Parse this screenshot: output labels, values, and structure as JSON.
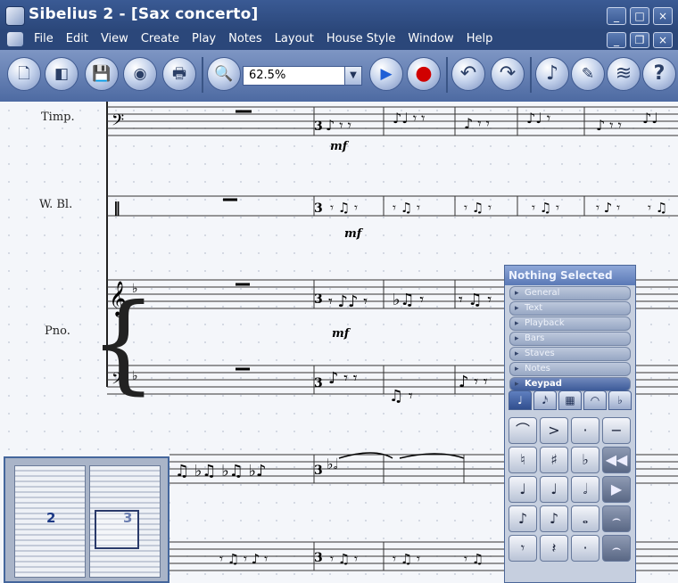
{
  "window": {
    "title": "Sibelius 2 - [Sax concerto]",
    "controls": [
      "_",
      "□",
      "×"
    ],
    "doc_controls": [
      "_",
      "❐",
      "×"
    ]
  },
  "menu": [
    "File",
    "Edit",
    "View",
    "Create",
    "Play",
    "Notes",
    "Layout",
    "House Style",
    "Window",
    "Help"
  ],
  "toolbar": {
    "buttons": [
      {
        "name": "new-icon",
        "glyph": "🗋"
      },
      {
        "name": "open-icon",
        "glyph": "◧"
      },
      {
        "name": "save-icon",
        "glyph": "💾"
      },
      {
        "name": "web-icon",
        "glyph": "◉"
      },
      {
        "name": "print-icon",
        "glyph": "🖶"
      },
      {
        "name": "zoom-icon",
        "glyph": "🔍"
      },
      {
        "name": "play-icon",
        "glyph": "▶"
      },
      {
        "name": "record-icon",
        "glyph": "●"
      },
      {
        "name": "undo-icon",
        "glyph": "↶"
      },
      {
        "name": "redo-icon",
        "glyph": "↷"
      },
      {
        "name": "note-icon",
        "glyph": "♪"
      },
      {
        "name": "eraser-icon",
        "glyph": "✎"
      },
      {
        "name": "flex-icon",
        "glyph": "≋"
      },
      {
        "name": "help-icon",
        "glyph": "?"
      }
    ],
    "zoom_value": "62.5%",
    "play_color": "#1f5fd6",
    "record_color": "#d00000"
  },
  "score": {
    "instruments": [
      "Timp.",
      "W. Bl.",
      "Pno."
    ],
    "dynamics": [
      "mf",
      "mf",
      "mf"
    ]
  },
  "navigator": {
    "pages": [
      "2",
      "3"
    ]
  },
  "properties": {
    "title": "Nothing Selected",
    "sections": [
      "General",
      "Text",
      "Playback",
      "Bars",
      "Staves",
      "Notes",
      "Keypad"
    ],
    "active_section": "Keypad",
    "tabs": [
      "♩",
      "𝅘𝅥𝅯",
      "▦",
      "◠",
      "♭"
    ],
    "keys": [
      "⌒",
      ">",
      "·",
      "−",
      "♮",
      "♯",
      "♭",
      "◀◀",
      "♩",
      "♩",
      "𝅗𝅥",
      "▶",
      "♪",
      "♪",
      "𝅝",
      "⌢",
      "𝄾",
      "𝄽",
      "·",
      "⌢"
    ]
  }
}
